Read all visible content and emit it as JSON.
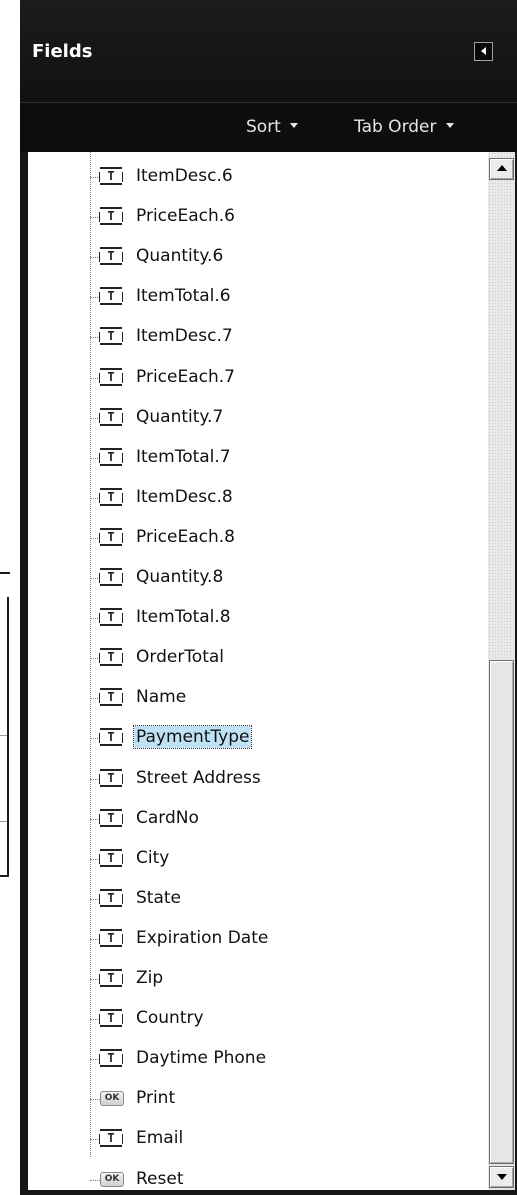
{
  "panel": {
    "title": "Fields",
    "collapse_icon": "triangle-left-icon"
  },
  "toolbar": {
    "sort_label": "Sort",
    "tab_order_label": "Tab Order"
  },
  "fields": [
    {
      "label": "ItemDesc.6",
      "icon": "text-field-icon"
    },
    {
      "label": "PriceEach.6",
      "icon": "text-field-icon"
    },
    {
      "label": "Quantity.6",
      "icon": "text-field-icon"
    },
    {
      "label": "ItemTotal.6",
      "icon": "text-field-icon"
    },
    {
      "label": "ItemDesc.7",
      "icon": "text-field-icon"
    },
    {
      "label": "PriceEach.7",
      "icon": "text-field-icon"
    },
    {
      "label": "Quantity.7",
      "icon": "text-field-icon"
    },
    {
      "label": "ItemTotal.7",
      "icon": "text-field-icon"
    },
    {
      "label": "ItemDesc.8",
      "icon": "text-field-icon"
    },
    {
      "label": "PriceEach.8",
      "icon": "text-field-icon"
    },
    {
      "label": "Quantity.8",
      "icon": "text-field-icon"
    },
    {
      "label": "ItemTotal.8",
      "icon": "text-field-icon"
    },
    {
      "label": "OrderTotal",
      "icon": "text-field-icon"
    },
    {
      "label": "Name",
      "icon": "text-field-icon"
    },
    {
      "label": "PaymentType",
      "icon": "text-field-icon",
      "selected": true
    },
    {
      "label": "Street Address",
      "icon": "text-field-icon"
    },
    {
      "label": "CardNo",
      "icon": "text-field-icon"
    },
    {
      "label": "City",
      "icon": "text-field-icon"
    },
    {
      "label": "State",
      "icon": "text-field-icon"
    },
    {
      "label": "Expiration Date",
      "icon": "text-field-icon"
    },
    {
      "label": "Zip",
      "icon": "text-field-icon"
    },
    {
      "label": "Country",
      "icon": "text-field-icon"
    },
    {
      "label": "Daytime Phone",
      "icon": "text-field-icon"
    },
    {
      "label": "Print",
      "icon": "button-field-icon"
    },
    {
      "label": "Email",
      "icon": "text-field-icon"
    },
    {
      "label": "Reset",
      "icon": "button-field-icon"
    }
  ],
  "icon_glyphs": {
    "text_field": "T",
    "button_field": "OK"
  },
  "scrollbar": {
    "position_fraction": 0.49
  },
  "colors": {
    "panel_bg": "#161616",
    "selection_bg": "#bfe3f5"
  }
}
